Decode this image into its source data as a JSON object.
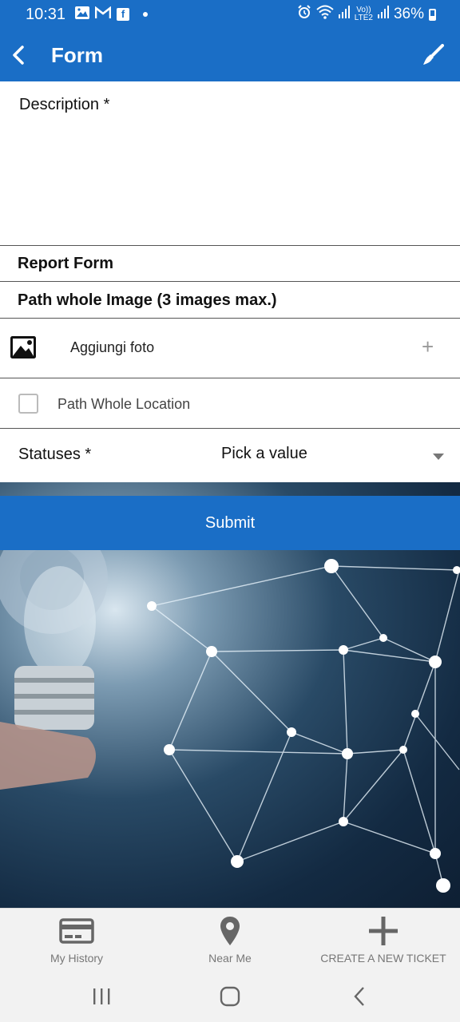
{
  "status_bar": {
    "time": "10:31",
    "battery": "36%",
    "network_label_top": "Vo))",
    "network_label_bottom": "LTE2",
    "left_icons": [
      "gallery-icon",
      "gmail-icon",
      "facebook-icon",
      "dot-icon"
    ],
    "right_icons": [
      "alarm-icon",
      "wifi-icon",
      "signal-icon",
      "signal-icon",
      "battery-icon"
    ]
  },
  "app_bar": {
    "title": "Form",
    "back_icon": "chevron-left-icon",
    "action_icon": "paintbrush-icon",
    "color": "#1a6ec6"
  },
  "form": {
    "description": {
      "label": "Description *",
      "value": ""
    },
    "report_form_header": "Report Form",
    "image_section_header": "Path whole Image (3 images max.)",
    "add_photo": {
      "label": "Aggiungi foto",
      "plus": "+",
      "icon": "image-icon"
    },
    "location": {
      "label": "Path Whole Location",
      "checked": false
    },
    "statuses": {
      "label": "Statuses *",
      "selected": "Pick a value"
    },
    "submit_label": "Submit"
  },
  "bottom_nav": {
    "items": [
      {
        "label": "My History",
        "icon": "credit-card-icon"
      },
      {
        "label": "Near Me",
        "icon": "map-pin-icon"
      },
      {
        "label": "CREATE A NEW TICKET",
        "icon": "plus-icon"
      }
    ]
  },
  "system_nav": [
    "recents-icon",
    "home-icon",
    "back-icon"
  ]
}
